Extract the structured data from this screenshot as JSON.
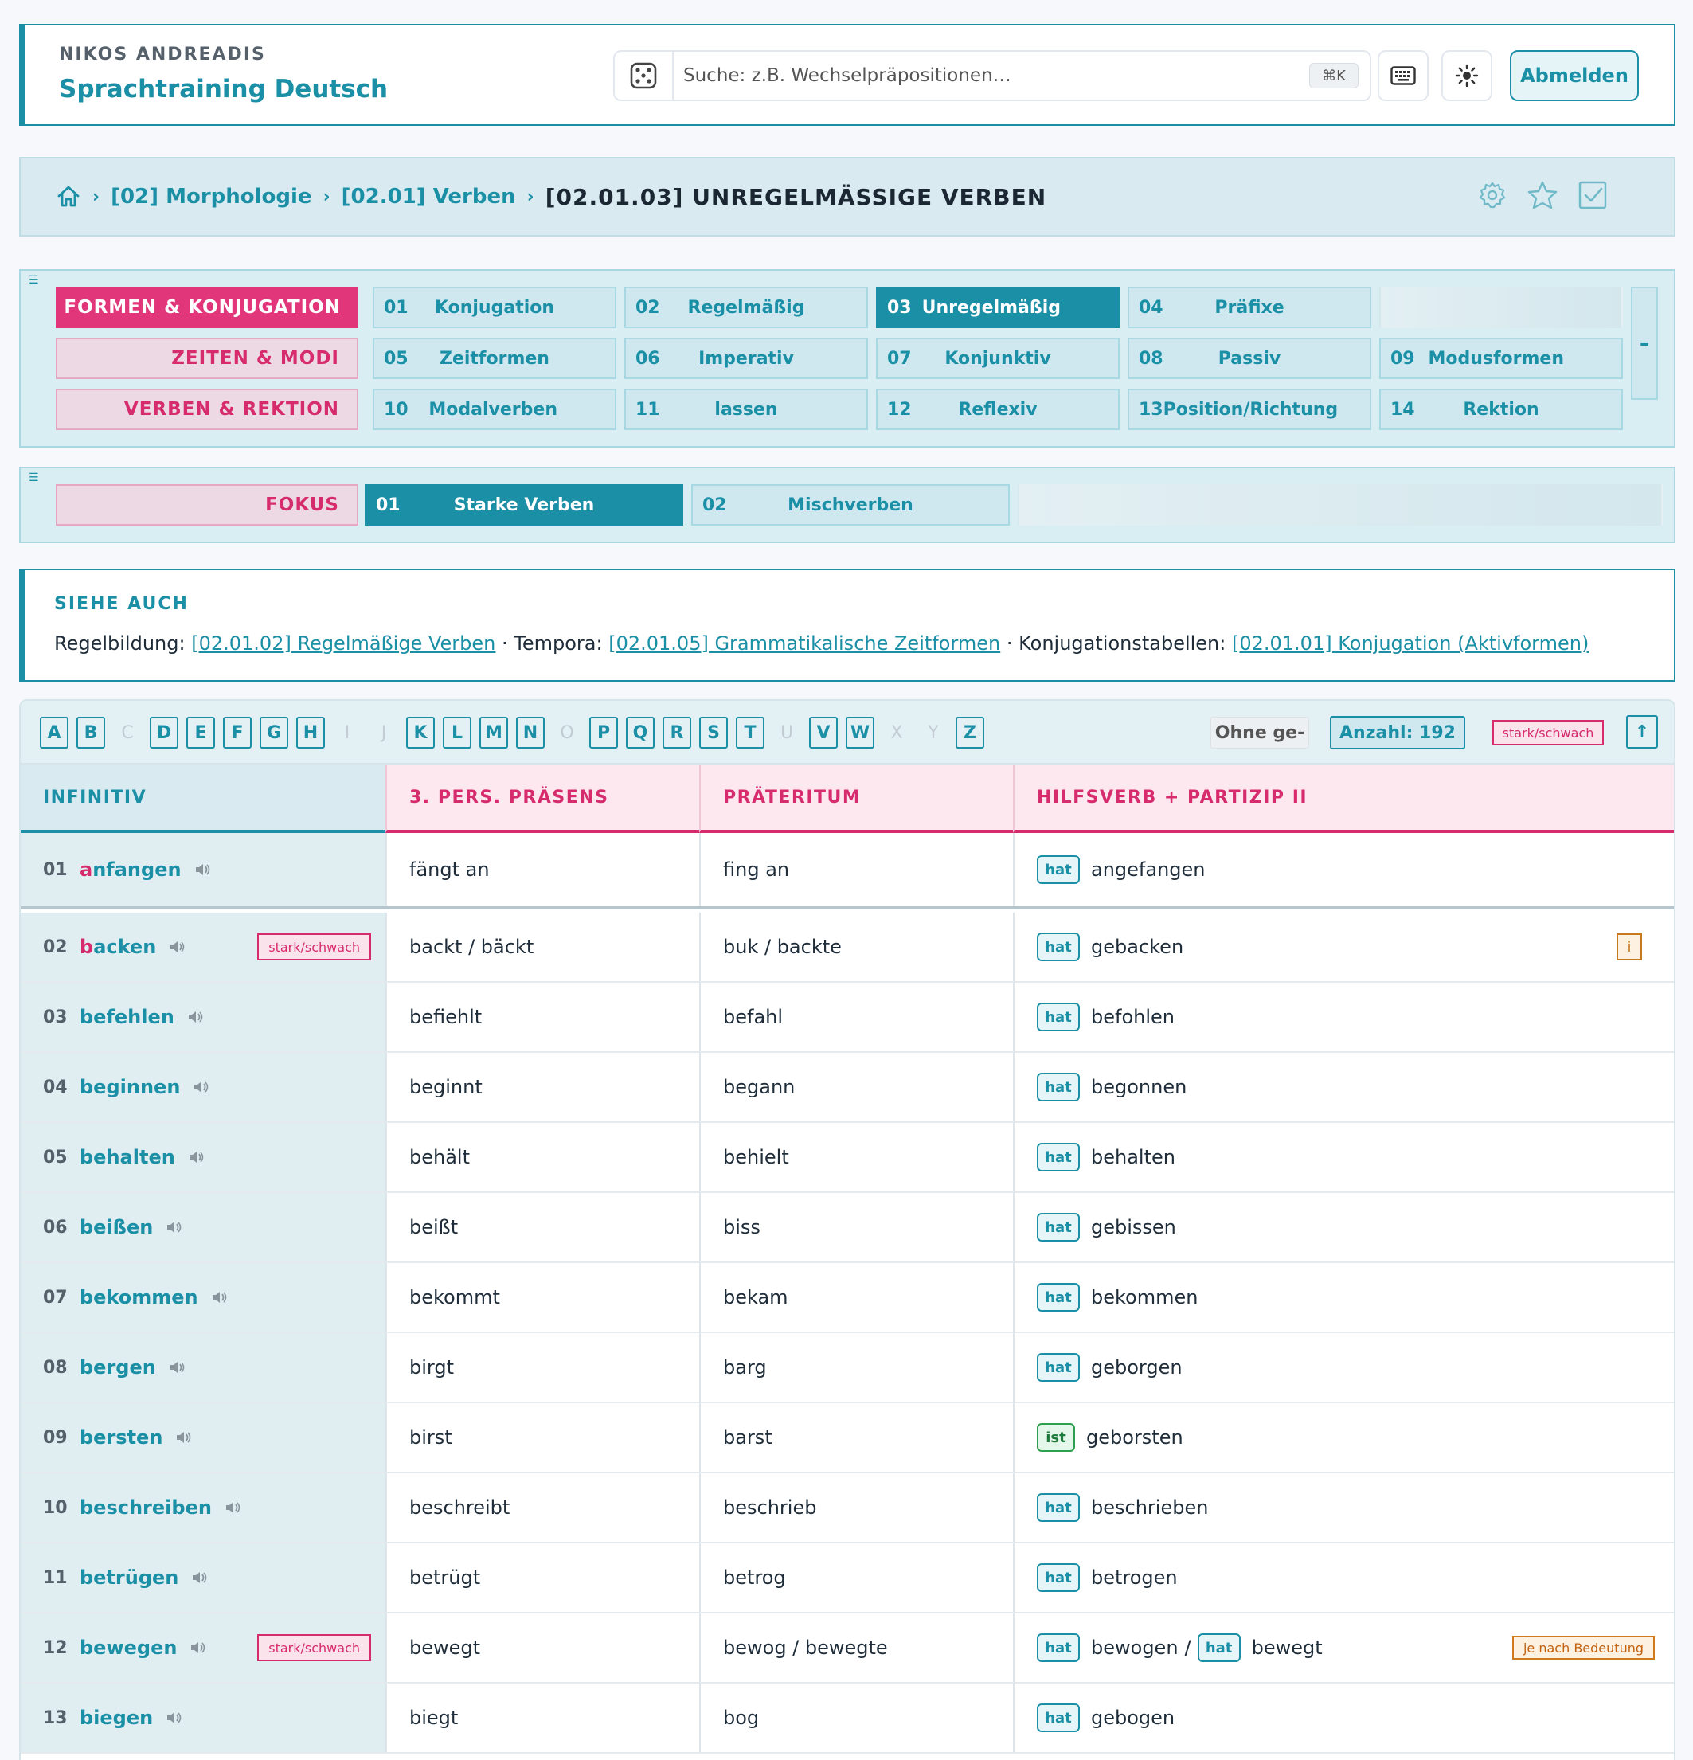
{
  "header": {
    "user_name": "NIKOS ANDREADIS",
    "app_title": "Sprachtraining Deutsch",
    "search_placeholder": "Suche: z.B. Wechselpräpositionen…",
    "search_shortcut": "⌘K",
    "logout_label": "Abmelden"
  },
  "breadcrumb": {
    "items": [
      "[02] Morphologie",
      "[02.01] Verben"
    ],
    "separator": "›",
    "current": "[02.01.03] UNREGELMÄSSIGE VERBEN"
  },
  "nav": {
    "categories": [
      "FORMEN & KONJUGATION",
      "ZEITEN & MODI",
      "VERBEN & REKTION"
    ],
    "tiles": [
      {
        "num": "01",
        "label": "Konjugation"
      },
      {
        "num": "02",
        "label": "Regelmäßig"
      },
      {
        "num": "03",
        "label": "Unregelmäßig"
      },
      {
        "num": "04",
        "label": "Präfixe"
      },
      {
        "num": "05",
        "label": "Zeitformen"
      },
      {
        "num": "06",
        "label": "Imperativ"
      },
      {
        "num": "07",
        "label": "Konjunktiv"
      },
      {
        "num": "08",
        "label": "Passiv"
      },
      {
        "num": "09",
        "label": "Modusformen"
      },
      {
        "num": "10",
        "label": "Modalverben"
      },
      {
        "num": "11",
        "label": "lassen"
      },
      {
        "num": "12",
        "label": "Reflexiv"
      },
      {
        "num": "13",
        "label": "Position/Richtung"
      },
      {
        "num": "14",
        "label": "Rektion"
      }
    ],
    "collapse_label": "–"
  },
  "focus": {
    "label": "FOKUS",
    "tiles": [
      {
        "num": "01",
        "label": "Starke Verben"
      },
      {
        "num": "02",
        "label": "Mischverben"
      }
    ]
  },
  "see_also": {
    "title": "SIEHE AUCH",
    "p1": "Regelbildung: ",
    "l1": "[02.01.02] Regelmäßige Verben",
    "p2": " · Tempora: ",
    "l2": "[02.01.05] Grammatikalische Zeitformen",
    "p3": " · Konjugationstabellen: ",
    "l3": "[02.01.01] Konjugation (Aktivformen)"
  },
  "alphabet": {
    "letters": [
      "A",
      "B",
      "C",
      "D",
      "E",
      "F",
      "G",
      "H",
      "I",
      "J",
      "K",
      "L",
      "M",
      "N",
      "O",
      "P",
      "Q",
      "R",
      "S",
      "T",
      "U",
      "V",
      "W",
      "X",
      "Y",
      "Z"
    ],
    "disabled": [
      "C",
      "I",
      "J",
      "O",
      "U",
      "X",
      "Y"
    ],
    "ohne_label": "Ohne ge-",
    "count_label": "Anzahl: 192",
    "filter_tag": "stark/schwach",
    "up_label": "↑"
  },
  "table": {
    "headers": [
      "INFINITIV",
      "3. PERS. PRÄSENS",
      "PRÄTERITUM",
      "HILFSVERB + PARTIZIP II"
    ],
    "rows": [
      {
        "num": "01",
        "hl": "a",
        "rest": "nfangen",
        "praesens": "fängt an",
        "praeteritum": "fing an",
        "aux": "hat",
        "partizip": "angefangen"
      },
      {
        "num": "02",
        "hl": "b",
        "rest": "acken",
        "tag": "stark/schwach",
        "praesens": "backt / bäckt",
        "praeteritum": "buk / backte",
        "aux": "hat",
        "partizip": "gebacken",
        "info": "i"
      },
      {
        "num": "03",
        "hl": "",
        "rest": "befehlen",
        "praesens": "befiehlt",
        "praeteritum": "befahl",
        "aux": "hat",
        "partizip": "befohlen"
      },
      {
        "num": "04",
        "hl": "",
        "rest": "beginnen",
        "praesens": "beginnt",
        "praeteritum": "begann",
        "aux": "hat",
        "partizip": "begonnen"
      },
      {
        "num": "05",
        "hl": "",
        "rest": "behalten",
        "praesens": "behält",
        "praeteritum": "behielt",
        "aux": "hat",
        "partizip": "behalten"
      },
      {
        "num": "06",
        "hl": "",
        "rest": "beißen",
        "praesens": "beißt",
        "praeteritum": "biss",
        "aux": "hat",
        "partizip": "gebissen"
      },
      {
        "num": "07",
        "hl": "",
        "rest": "bekommen",
        "praesens": "bekommt",
        "praeteritum": "bekam",
        "aux": "hat",
        "partizip": "bekommen"
      },
      {
        "num": "08",
        "hl": "",
        "rest": "bergen",
        "praesens": "birgt",
        "praeteritum": "barg",
        "aux": "hat",
        "partizip": "geborgen"
      },
      {
        "num": "09",
        "hl": "",
        "rest": "bersten",
        "praesens": "birst",
        "praeteritum": "barst",
        "aux": "ist",
        "partizip": "geborsten"
      },
      {
        "num": "10",
        "hl": "",
        "rest": "beschreiben",
        "praesens": "beschreibt",
        "praeteritum": "beschrieb",
        "aux": "hat",
        "partizip": "beschrieben"
      },
      {
        "num": "11",
        "hl": "",
        "rest": "betrügen",
        "praesens": "betrügt",
        "praeteritum": "betrog",
        "aux": "hat",
        "partizip": "betrogen"
      },
      {
        "num": "12",
        "hl": "",
        "rest": "bewegen",
        "tag": "stark/schwach",
        "praesens": "bewegt",
        "praeteritum": "bewog / bewegte",
        "aux": "hat",
        "partizip": "bewogen",
        "sep": "/",
        "aux2": "hat",
        "partizip2": "bewegt",
        "note": "je nach Bedeutung"
      },
      {
        "num": "13",
        "hl": "",
        "rest": "biegen",
        "praesens": "biegt",
        "praeteritum": "bog",
        "aux": "hat",
        "partizip": "gebogen"
      }
    ]
  },
  "colors": {
    "teal": "#1a8fa6",
    "pink": "#d62b6c",
    "green": "#2e9e4f",
    "orange": "#c77a1d"
  }
}
